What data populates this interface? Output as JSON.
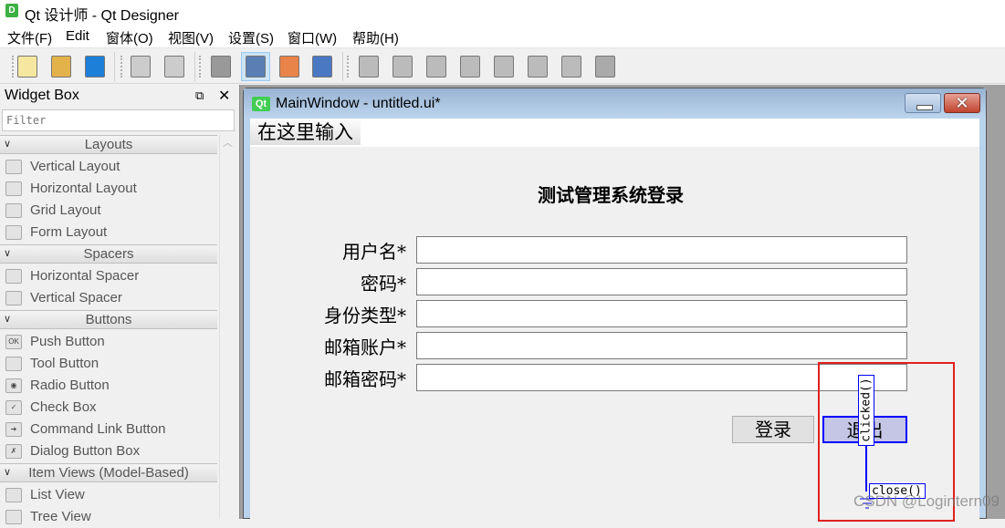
{
  "app": {
    "title": "Qt 设计师 - Qt Designer",
    "icon": "D"
  },
  "menu": [
    "文件(F)",
    "Edit",
    "窗体(O)",
    "视图(V)",
    "设置(S)",
    "窗口(W)",
    "帮助(H)"
  ],
  "toolbar": [
    "new-icon",
    "open-icon",
    "save-icon",
    "send-to-back-icon",
    "bring-to-front-icon",
    "edit-widgets-icon",
    "edit-signals-slots-icon",
    "edit-buddies-icon",
    "edit-tab-order-icon",
    "layout-horizontal-icon",
    "layout-vertical-icon",
    "layout-horizontal-splitter-icon",
    "layout-vertical-splitter-icon",
    "layout-grid-icon",
    "layout-form-icon",
    "break-layout-icon",
    "adjust-size-icon"
  ],
  "toolbar_active": "edit-signals-slots-icon",
  "widget_box": {
    "title": "Widget Box",
    "filter_placeholder": "Filter",
    "categories": [
      {
        "label": "Layouts",
        "items": [
          "Vertical Layout",
          "Horizontal Layout",
          "Grid Layout",
          "Form Layout"
        ]
      },
      {
        "label": "Spacers",
        "items": [
          "Horizontal Spacer",
          "Vertical Spacer"
        ]
      },
      {
        "label": "Buttons",
        "items": [
          "Push Button",
          "Tool Button",
          "Radio Button",
          "Check Box",
          "Command Link Button",
          "Dialog Button Box"
        ]
      },
      {
        "label": "Item Views (Model-Based)",
        "items": [
          "List View",
          "Tree View"
        ]
      }
    ]
  },
  "form_window": {
    "title": "MainWindow - untitled.ui*",
    "icon": "Qt",
    "menu_placeholder": "在这里输入",
    "heading": "测试管理系统登录",
    "fields": [
      {
        "label": "用户名*",
        "value": ""
      },
      {
        "label": "密码*",
        "value": ""
      },
      {
        "label": "身份类型*",
        "value": ""
      },
      {
        "label": "邮箱账户*",
        "value": ""
      },
      {
        "label": "邮箱密码*",
        "value": ""
      }
    ],
    "login_button": "登录",
    "quit_button": "退出",
    "connection": {
      "signal": "clicked()",
      "slot": "close()"
    }
  },
  "watermark": "CSDN @Logintern09",
  "colors": {
    "connection": "#0000ff",
    "highlight": "#e02020",
    "selected_button": "#c5c5e6"
  }
}
